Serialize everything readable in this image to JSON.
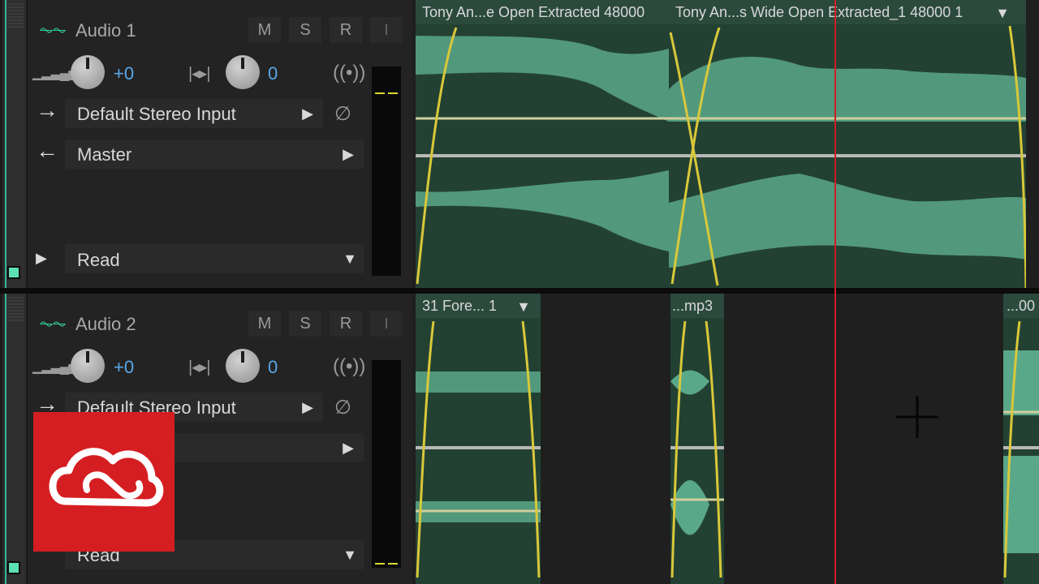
{
  "colors": {
    "accent_green": "#35d39c",
    "clip_wave": "#5aa88a",
    "fade_curve": "#d8c83a",
    "playhead": "#d01c24",
    "volume_blue": "#5aa6e8",
    "logo_red": "#d51e21"
  },
  "tracks": [
    {
      "name": "Audio 1",
      "mute": "M",
      "solo": "S",
      "record": "R",
      "input_monitor": "I",
      "volume": "+0",
      "pan": "0",
      "input": "Default Stereo Input",
      "output": "Master",
      "automation": "Read",
      "clips": [
        {
          "title": "Tony An...e Open Extracted 48000"
        },
        {
          "title": "Tony An...s Wide Open Extracted_1 48000 1"
        }
      ]
    },
    {
      "name": "Audio 2",
      "mute": "M",
      "solo": "S",
      "record": "R",
      "input_monitor": "I",
      "volume": "+0",
      "pan": "0",
      "input": "Default Stereo Input",
      "output": "",
      "automation": "Read",
      "clips": [
        {
          "title": "31 Fore... 1"
        },
        {
          "title": "...mp3"
        },
        {
          "title": "...00"
        }
      ]
    }
  ],
  "icons": {
    "waveform": "waveform-icon",
    "volume": "volume-icon",
    "pan": "pan-icon",
    "monitor": "broadcast-icon",
    "phase": "phase-invert-icon",
    "input_arrow": "arrow-right-icon",
    "output_arrow": "arrow-left-icon",
    "logo": "creative-cloud-logo"
  }
}
